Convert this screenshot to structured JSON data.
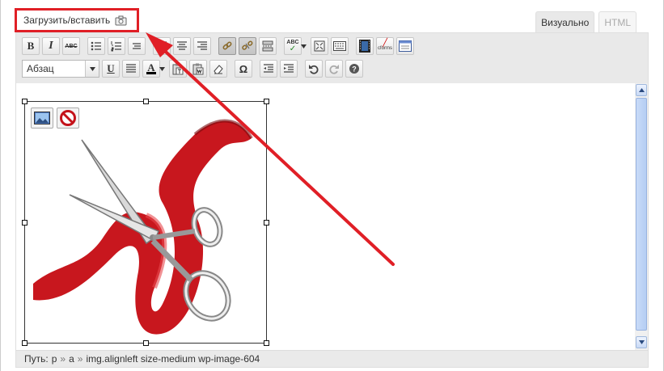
{
  "upload": {
    "label": "Загрузить/вставить"
  },
  "tabs": [
    {
      "label": "Визуально",
      "active": true
    },
    {
      "label": "HTML",
      "active": false
    }
  ],
  "toolbar": {
    "format_select": "Абзац",
    "row1": [
      "bold",
      "italic",
      "strikethrough",
      "bulleted-list",
      "numbered-list",
      "blockquote",
      "align-left",
      "align-center",
      "align-right",
      "insert-link",
      "unlink",
      "insert-more",
      "spellcheck",
      "fullscreen",
      "toggle-kitchen-sink",
      "insert-video",
      "cforms",
      "insert-gallery"
    ],
    "row2": [
      "underline",
      "justify",
      "text-color",
      "paste-as-text",
      "paste-from-word",
      "remove-formatting",
      "special-character",
      "outdent",
      "indent",
      "undo",
      "redo",
      "help"
    ],
    "labels": {
      "bold": "B",
      "italic": "I",
      "strike": "ABC",
      "underline": "U",
      "omega": "Ω",
      "text_color": "A",
      "spell": "ABC",
      "cforms": "cforms"
    }
  },
  "image_tools": [
    "edit-image",
    "delete-image"
  ],
  "path": {
    "label": "Путь:",
    "items": [
      "p",
      "a",
      "img.alignleft size-medium wp-image-604"
    ],
    "separator": "»"
  },
  "colors": {
    "highlight": "#e01f26",
    "ribbon": "#c8171e"
  }
}
